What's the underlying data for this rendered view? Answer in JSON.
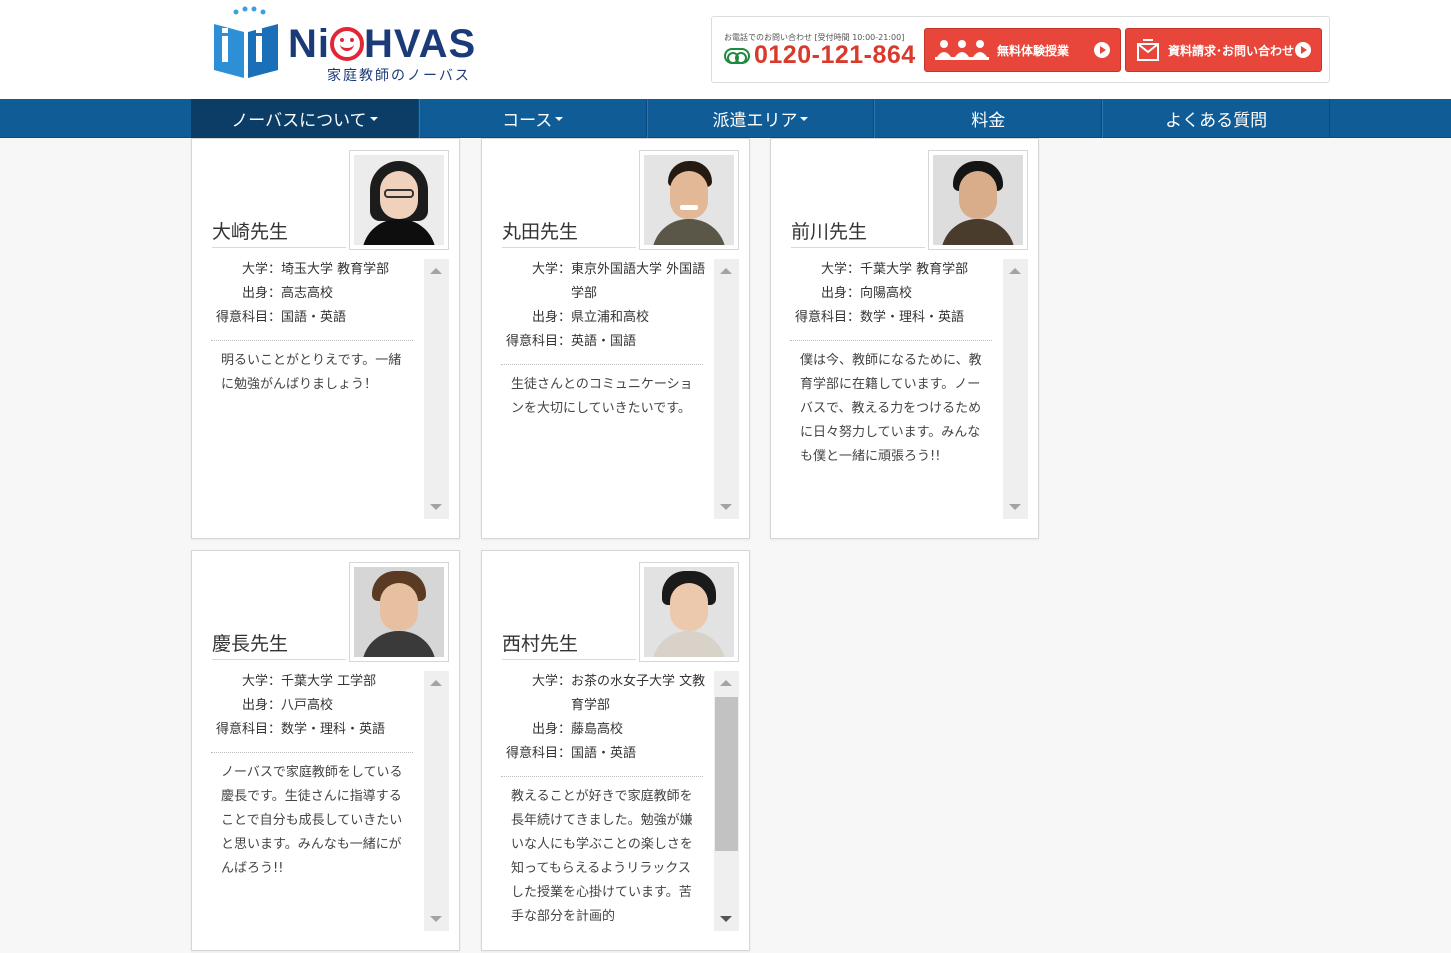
{
  "header": {
    "logo_text": "NiOHVAS",
    "logo_sub": "家庭教師のノーバス",
    "contact_note": "お電話でのお問い合わせ [受付時間 10:00-21:00]",
    "phone": "0120-121-864",
    "trial_button": "無料体験授業",
    "inquiry_button": "資料請求･お問い合わせ"
  },
  "nav": [
    {
      "label": "ノーバスについて",
      "dropdown": true
    },
    {
      "label": "コース",
      "dropdown": true
    },
    {
      "label": "派遣エリア",
      "dropdown": true
    },
    {
      "label": "料金",
      "dropdown": false
    },
    {
      "label": "よくある質問",
      "dropdown": false
    }
  ],
  "teachers": [
    {
      "name": "大崎先生",
      "info": [
        {
          "k": "大学：",
          "v": "埼玉大学 教育学部"
        },
        {
          "k": "出身：",
          "v": "高志高校"
        },
        {
          "k": "得意科目：",
          "v": "国語・英語"
        }
      ],
      "message": "明るいことがとりえです。一緒に勉強がんばりましょう！"
    },
    {
      "name": "丸田先生",
      "info": [
        {
          "k": "大学：",
          "v": "東京外国語大学 外国語学部"
        },
        {
          "k": "出身：",
          "v": "県立浦和高校"
        },
        {
          "k": "得意科目：",
          "v": "英語・国語"
        }
      ],
      "message": "生徒さんとのコミュニケーションを大切にしていきたいです。"
    },
    {
      "name": "前川先生",
      "info": [
        {
          "k": "大学：",
          "v": "千葉大学 教育学部"
        },
        {
          "k": "出身：",
          "v": "向陽高校"
        },
        {
          "k": "得意科目：",
          "v": "数学・理科・英語"
        }
      ],
      "message": "僕は今、教師になるために、教育学部に在籍しています。ノーバスで、教える力をつけるために日々努力しています。みんなも僕と一緒に頑張ろう!!"
    },
    {
      "name": "慶長先生",
      "info": [
        {
          "k": "大学：",
          "v": "千葉大学 工学部"
        },
        {
          "k": "出身：",
          "v": "八戸高校"
        },
        {
          "k": "得意科目：",
          "v": "数学・理科・英語"
        }
      ],
      "message": "ノーバスで家庭教師をしている慶長です。生徒さんに指導することで自分も成長していきたいと思います。みんなも一緒にがんばろう!!"
    },
    {
      "name": "西村先生",
      "info": [
        {
          "k": "大学：",
          "v": "お茶の水女子大学 文教育学部"
        },
        {
          "k": "出身：",
          "v": "藤島高校"
        },
        {
          "k": "得意科目：",
          "v": "国語・英語"
        }
      ],
      "message": "教えることが好きで家庭教師を長年続けてきました。勉強が嫌いな人にも学ぶことの楽しさを知ってもらえるようリラックスした授業を心掛けています。苦手な部分を計画的"
    }
  ],
  "colors": {
    "nav_bg": "#0f5c96",
    "nav_active": "#0b3d66",
    "cta_red": "#e8463a",
    "phone_red": "#d93a2b",
    "phone_green": "#1e8a3c",
    "logo_blue": "#1b3a78"
  },
  "icons": {
    "trial": "students-icon",
    "inquiry": "mail-icon",
    "arrow": "play-circle-icon"
  }
}
